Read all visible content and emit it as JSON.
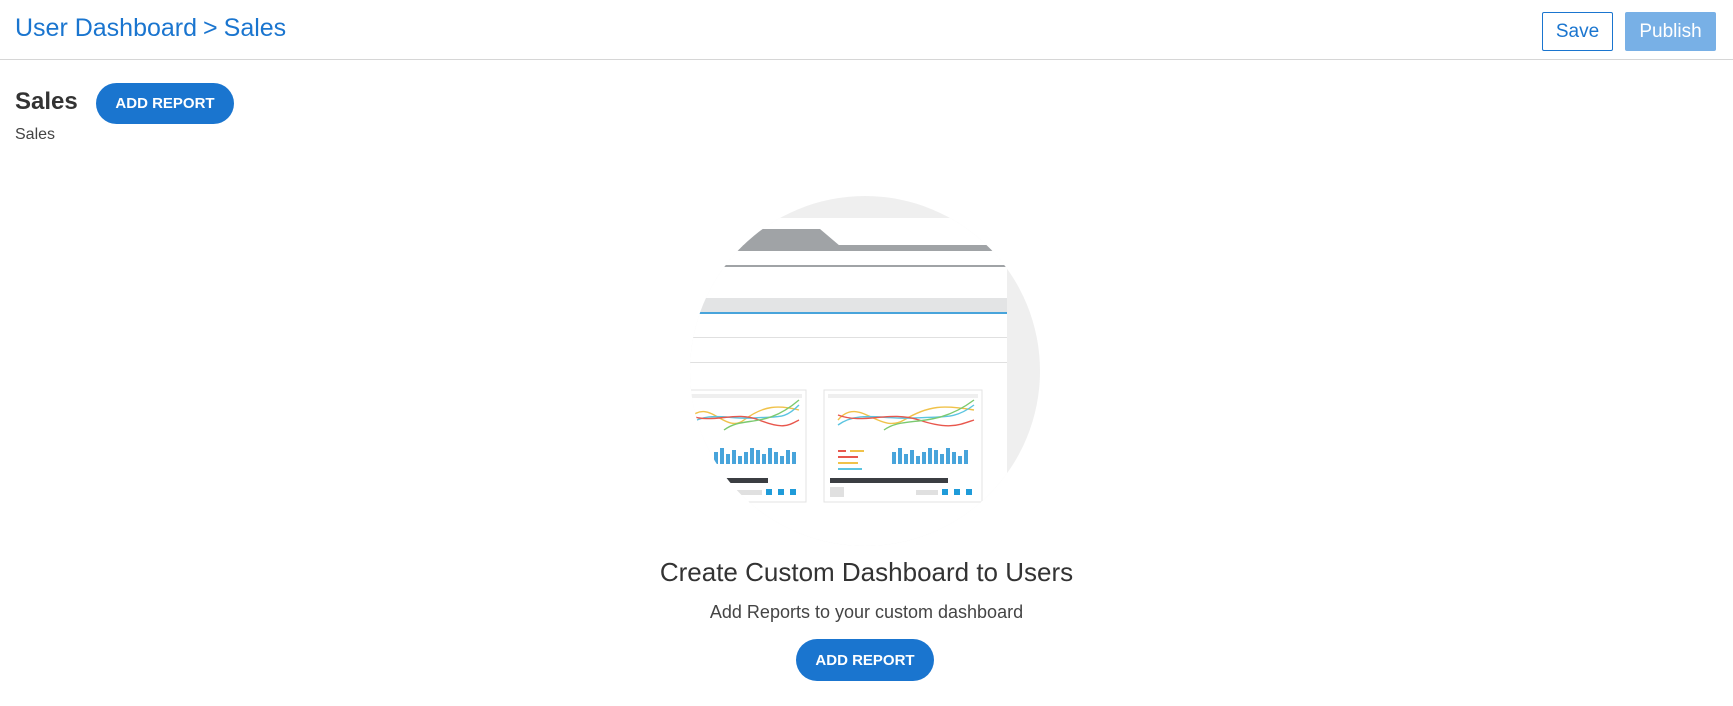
{
  "header": {
    "breadcrumb": [
      {
        "label": "User Dashboard"
      },
      {
        "label": "Sales"
      }
    ],
    "separator": ">",
    "save_label": "Save",
    "publish_label": "Publish"
  },
  "section": {
    "title": "Sales",
    "subtitle": "Sales",
    "add_report_label": "ADD REPORT"
  },
  "empty_state": {
    "title": "Create Custom Dashboard to Users",
    "subtitle": "Add Reports to your custom dashboard",
    "add_report_label": "ADD REPORT"
  },
  "colors": {
    "primary": "#1a75cf",
    "publish_disabled": "#78b0e6",
    "divider": "#d6d6d6"
  }
}
